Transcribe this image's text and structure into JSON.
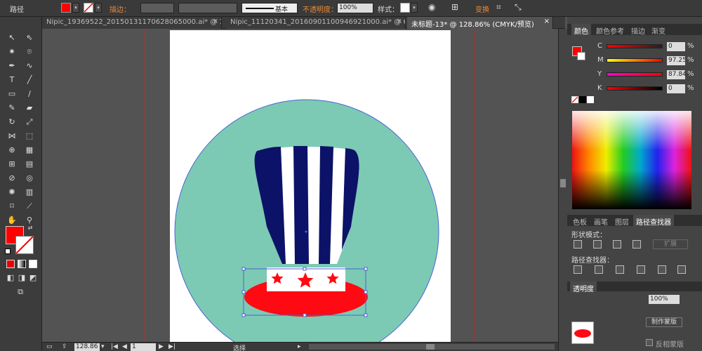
{
  "control_bar": {
    "object_type": "路径",
    "stroke_label": "描边：",
    "stroke_style": "基本",
    "opacity_label": "不透明度：",
    "opacity_value": "100%",
    "style_label": "样式：",
    "transform_label": "变换",
    "fill_color": "#ff0000"
  },
  "tabs": [
    {
      "label": "Nipic_19369522_20150131170628065000.ai* @ 10...",
      "active": false
    },
    {
      "label": "Nipic_11120341_20160901100946921000.ai* @ 66...",
      "active": false
    },
    {
      "label": "未标题-13* @ 128.86% (CMYK/预览)",
      "active": true
    }
  ],
  "tabs_close_glyph": "×",
  "color_panel": {
    "tabs": [
      "颜色",
      "颜色参考",
      "描边",
      "渐变"
    ],
    "channels": [
      {
        "label": "C",
        "value": "0",
        "unit": "%"
      },
      {
        "label": "M",
        "value": "97.25",
        "unit": "%"
      },
      {
        "label": "Y",
        "value": "87.84",
        "unit": "%"
      },
      {
        "label": "K",
        "value": "0",
        "unit": "%"
      }
    ]
  },
  "pathfinder_panel": {
    "tabs": [
      "色板",
      "画笔",
      "图层",
      "路径查找器"
    ],
    "shape_modes_label": "形状模式：",
    "expand_button": "扩展",
    "pathfinders_label": "路径查找器："
  },
  "transparency_panel": {
    "title": "透明度",
    "opacity_value": "100%",
    "make_mask_button": "制作蒙版",
    "invert_mask_label": "反相蒙版"
  },
  "status_bar": {
    "zoom": "128.86",
    "page": "1",
    "tool_hint": "选择"
  },
  "colors": {
    "circle": "#7ccab3",
    "stripe_dark": "#0c1268",
    "brim_red": "#ff0a12",
    "selection": "#4b62d8"
  }
}
